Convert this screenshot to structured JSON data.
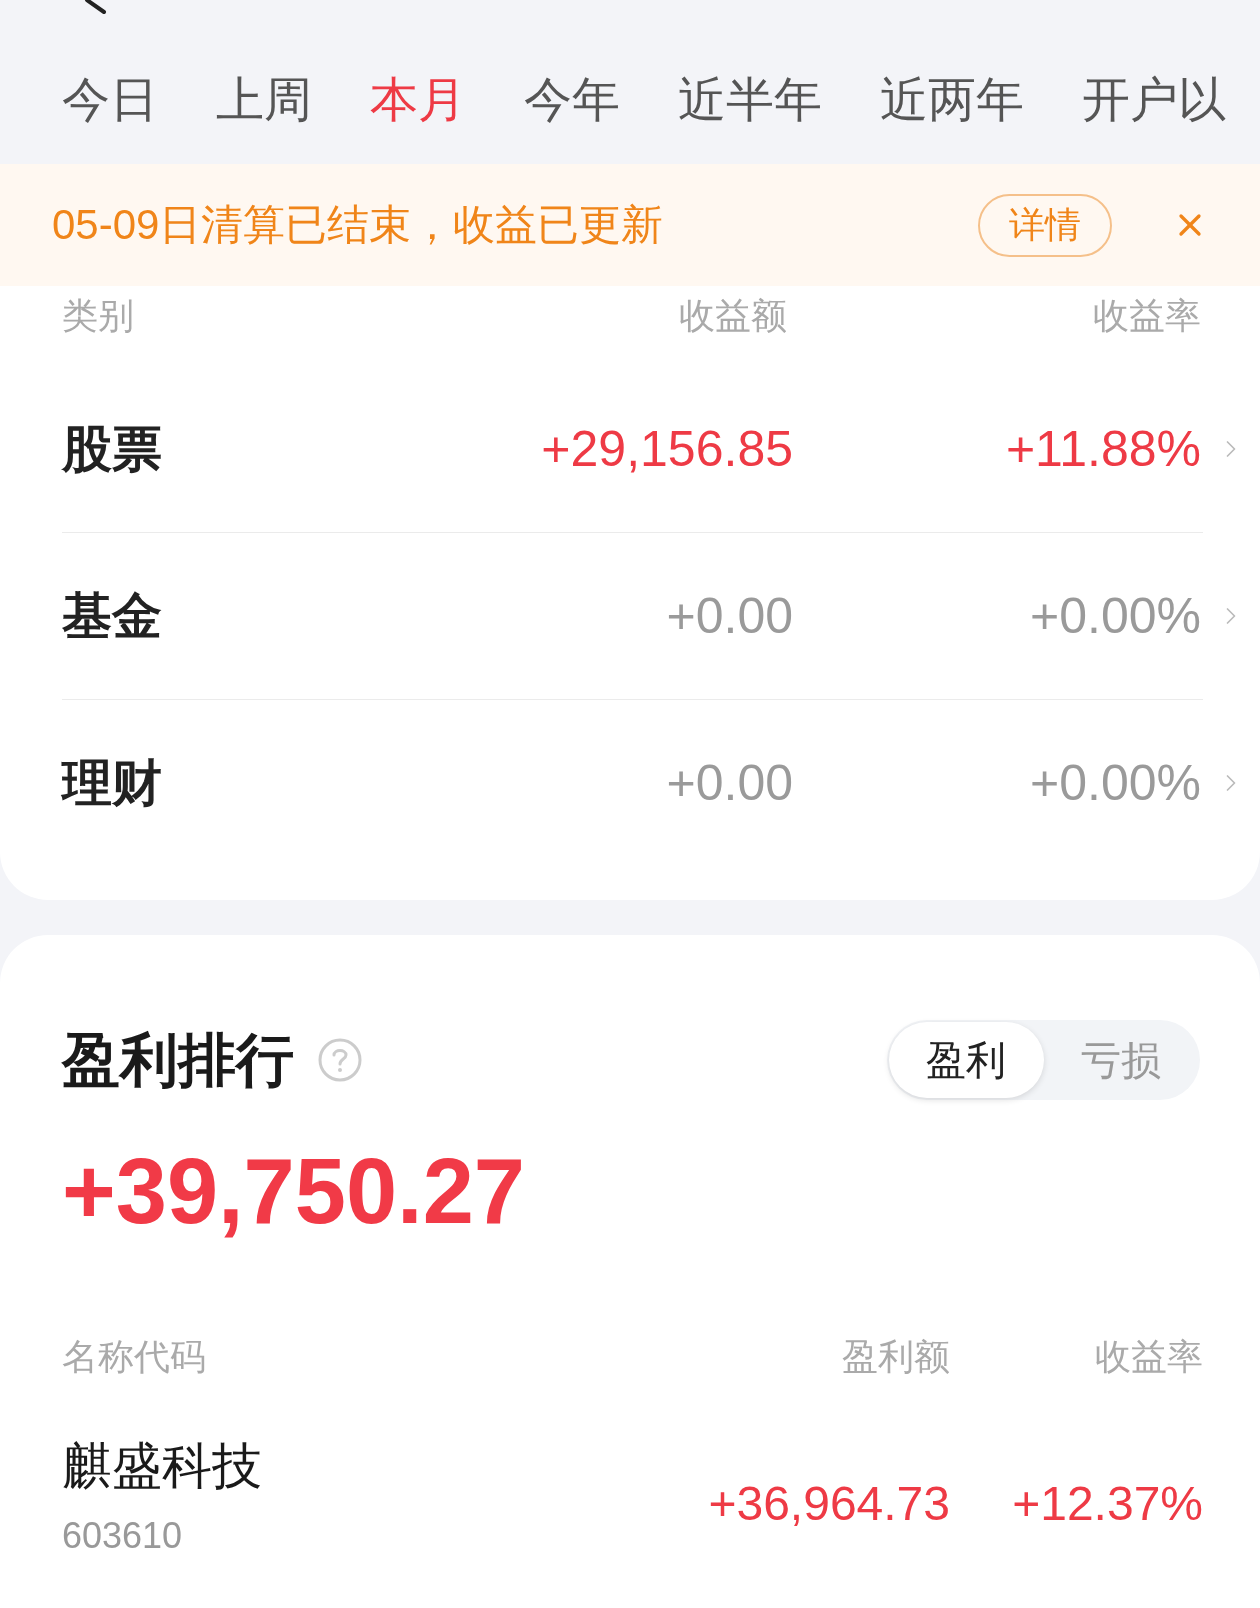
{
  "period_tabs": [
    {
      "label": "今日",
      "selected": false
    },
    {
      "label": "上周",
      "selected": false
    },
    {
      "label": "本月",
      "selected": true
    },
    {
      "label": "今年",
      "selected": false
    },
    {
      "label": "近半年",
      "selected": false
    },
    {
      "label": "近两年",
      "selected": false
    },
    {
      "label": "开户以",
      "selected": false
    }
  ],
  "notice": {
    "text": "05-09日清算已结束，收益已更新",
    "button": "详情"
  },
  "categories": {
    "columns": [
      "类别",
      "收益额",
      "收益率"
    ],
    "rows": [
      {
        "name": "股票",
        "amount": "+29,156.85",
        "rate": "+11.88%",
        "gain": true
      },
      {
        "name": "基金",
        "amount": "+0.00",
        "rate": "+0.00%",
        "gain": false
      },
      {
        "name": "理财",
        "amount": "+0.00",
        "rate": "+0.00%",
        "gain": false
      }
    ]
  },
  "ranking": {
    "title": "盈利排行",
    "toggle": [
      {
        "label": "盈利",
        "selected": true
      },
      {
        "label": "亏损",
        "selected": false
      }
    ],
    "total": "+39,750.27",
    "columns": [
      "名称代码",
      "盈利额",
      "收益率"
    ],
    "rows": [
      {
        "name": "麒盛科技",
        "code": "603610",
        "amount": "+36,964.73",
        "rate": "+12.37%",
        "gain": true
      }
    ]
  }
}
